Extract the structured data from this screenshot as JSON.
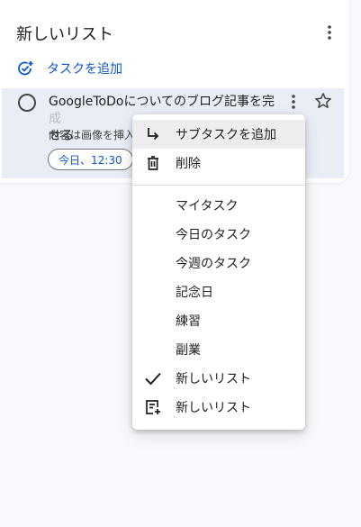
{
  "list": {
    "title": "新しいリスト",
    "add_task_label": "タスクを追加"
  },
  "task": {
    "title_visible": "GoogleToDoについてのブログ記事を完",
    "title_faded": "成",
    "title_line2": "せる",
    "notes": "内容は画像を挿入",
    "due_chip": "今日、12:30"
  },
  "menu": {
    "actions": [
      {
        "label": "サブタスクを追加",
        "icon": "subdirectory-arrow-icon"
      },
      {
        "label": "削除",
        "icon": "trash-icon"
      }
    ],
    "lists": [
      {
        "label": "マイタスク",
        "checked": false
      },
      {
        "label": "今日のタスク",
        "checked": false
      },
      {
        "label": "今週のタスク",
        "checked": false
      },
      {
        "label": "記念日",
        "checked": false
      },
      {
        "label": "練習",
        "checked": false
      },
      {
        "label": "副業",
        "checked": false
      },
      {
        "label": "新しいリスト",
        "checked": true
      },
      {
        "label": "新しいリスト",
        "icon": "new-list-icon"
      }
    ]
  },
  "colors": {
    "accent": "#0b57d0",
    "task_bg": "#e9eef6",
    "page_bg": "#f8f9fd"
  }
}
